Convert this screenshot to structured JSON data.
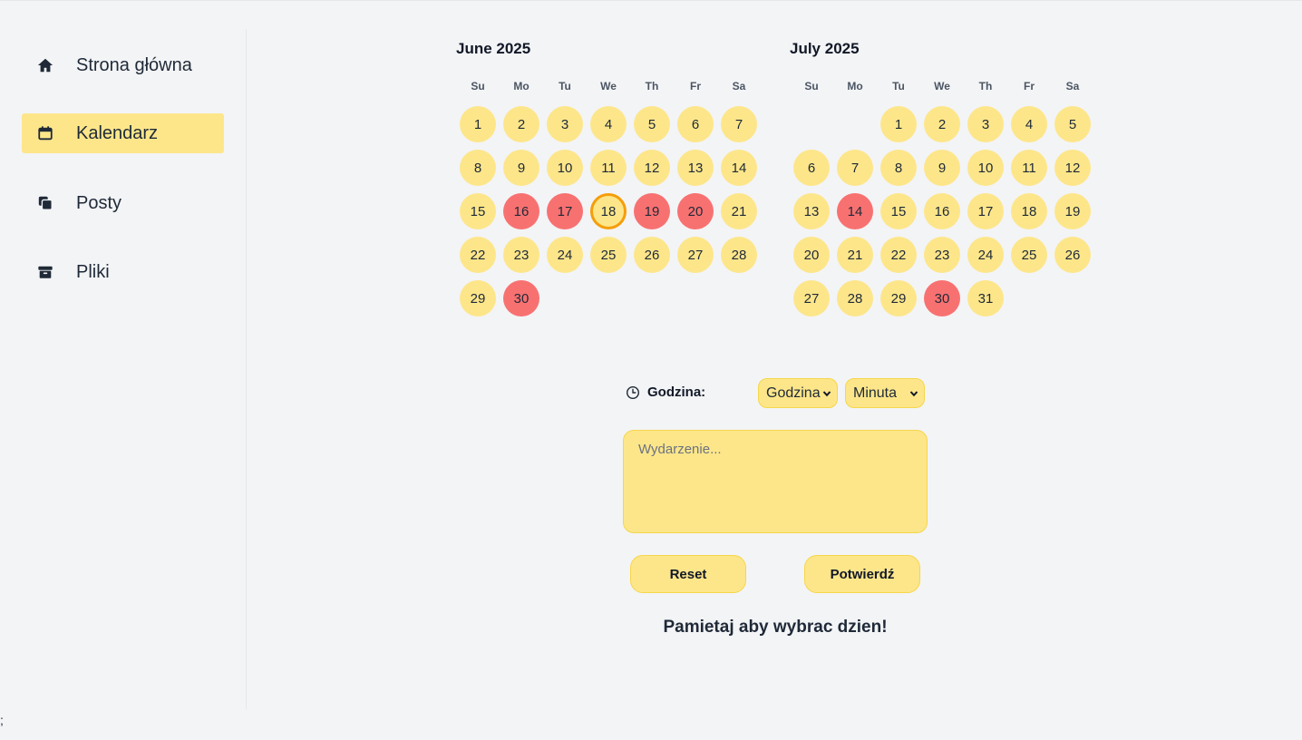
{
  "sidebar": {
    "items": [
      {
        "label": "Strona główna",
        "icon": "home-icon"
      },
      {
        "label": "Kalendarz",
        "icon": "calendar-icon",
        "active": true
      },
      {
        "label": "Posty",
        "icon": "copy-icon"
      },
      {
        "label": "Pliki",
        "icon": "archive-icon"
      }
    ]
  },
  "calendar": {
    "weekdays": [
      "Su",
      "Mo",
      "Tu",
      "We",
      "Th",
      "Fr",
      "Sa"
    ],
    "months": [
      {
        "title": "June 2025",
        "first_weekday": 0,
        "days_in_month": 30,
        "busy_days": [
          16,
          17,
          19,
          20,
          30
        ],
        "selected_day": 18
      },
      {
        "title": "July 2025",
        "first_weekday": 2,
        "days_in_month": 31,
        "busy_days": [
          14,
          30
        ],
        "selected_day": null
      }
    ]
  },
  "colors": {
    "day_available": "#fde68a",
    "day_busy": "#f87171",
    "day_selected_ring": "#f59e0b",
    "background": "#f3f4f6"
  },
  "form": {
    "time_label": "Godzina:",
    "hour_select": "Godzina",
    "minute_select": "Minuta",
    "event_placeholder": "Wydarzenie...",
    "reset_label": "Reset",
    "confirm_label": "Potwierdź",
    "reminder": "Pamietaj aby wybrac dzien!"
  },
  "stray_text": ";"
}
